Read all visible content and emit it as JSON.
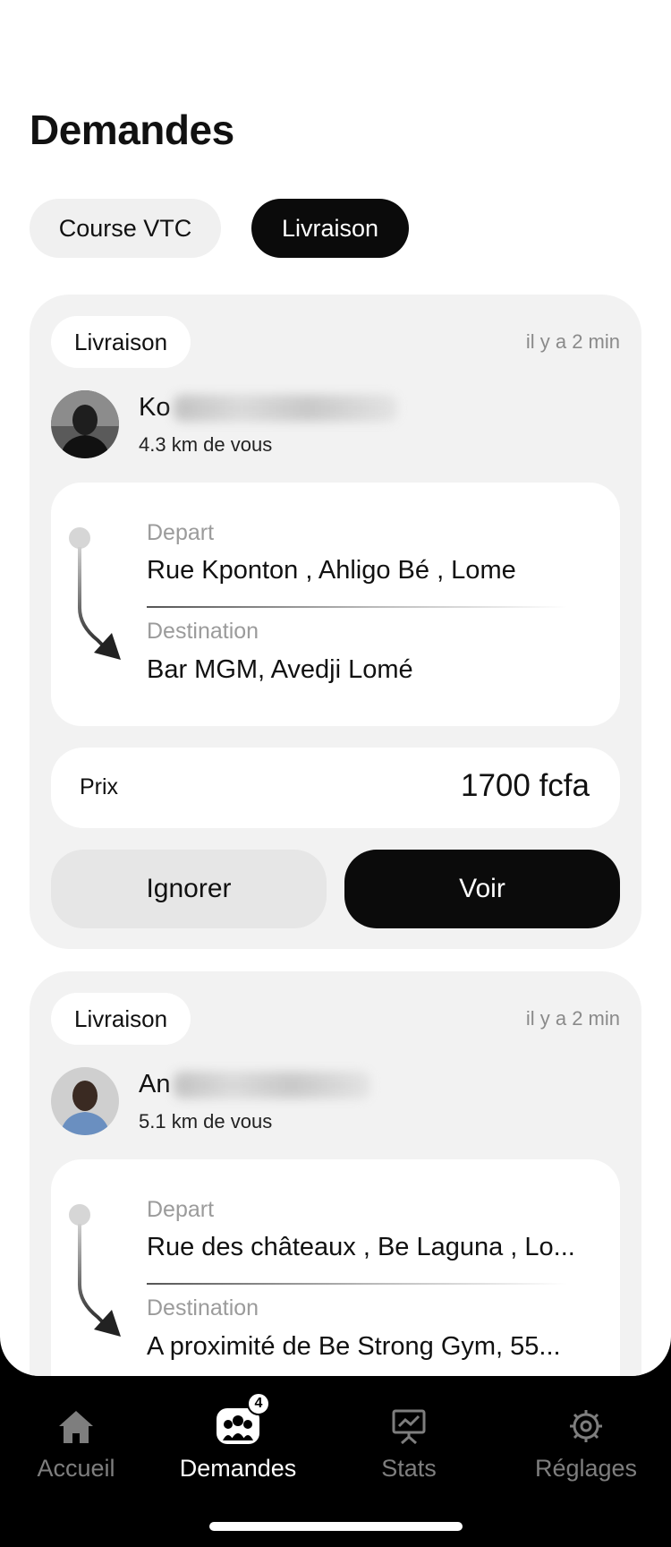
{
  "header": {
    "title": "Demandes"
  },
  "segments": [
    {
      "label": "Course VTC",
      "selected": false
    },
    {
      "label": "Livraison",
      "selected": true
    }
  ],
  "requests": [
    {
      "type": "Livraison",
      "time": "il y a 2 min",
      "name": "Ko",
      "distance": "4.3 km de vous",
      "depart_label": "Depart",
      "depart": "Rue Kponton , Ahligo Bé , Lome",
      "destination_label": "Destination",
      "destination": "Bar MGM, Avedji Lomé",
      "price_label": "Prix",
      "price": "1700 fcfa",
      "ignore_label": "Ignorer",
      "view_label": "Voir"
    },
    {
      "type": "Livraison",
      "time": "il y a 2 min",
      "name": "An",
      "distance": "5.1 km de vous",
      "depart_label": "Depart",
      "depart": "Rue des châteaux , Be Laguna , Lo...",
      "destination_label": "Destination",
      "destination": "A proximité de Be Strong Gym, 55..."
    }
  ],
  "tabbar": {
    "items": [
      {
        "label": "Accueil",
        "icon": "home-icon",
        "active": false
      },
      {
        "label": "Demandes",
        "icon": "group-icon",
        "active": true,
        "badge": "4"
      },
      {
        "label": "Stats",
        "icon": "chart-board-icon",
        "active": false
      },
      {
        "label": "Réglages",
        "icon": "gear-icon",
        "active": false
      }
    ]
  },
  "colors": {
    "accent": "#0b0b0b",
    "card_bg": "#f2f2f2",
    "muted": "#8a8a8a"
  }
}
